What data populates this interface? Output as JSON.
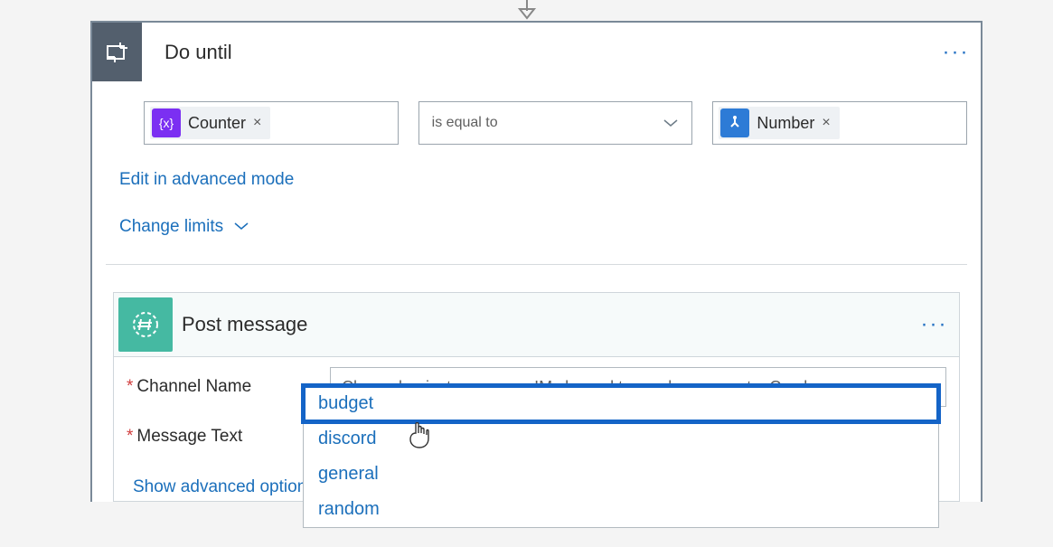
{
  "do_until": {
    "title": "Do until",
    "icon": "loop-icon",
    "menu_label": "···",
    "condition": {
      "left_token": {
        "badge": "{x}",
        "label": "Counter",
        "remove": "×"
      },
      "operator": {
        "label": "is equal to"
      },
      "right_token": {
        "badge": "hand-icon",
        "label": "Number",
        "remove": "×"
      }
    },
    "edit_advanced_link": "Edit in advanced mode",
    "change_limits_link": "Change limits"
  },
  "post_message": {
    "title": "Post message",
    "icon": "hash-icon",
    "menu_label": "···",
    "fields": {
      "channel_name": {
        "label": "Channel Name",
        "required_mark": "*",
        "placeholder": "Channel, private group, or IM channel to send message to. Can be a nam"
      },
      "message_text": {
        "label": "Message Text",
        "required_mark": "*"
      }
    },
    "dropdown_options": [
      "budget",
      "discord",
      "general",
      "random"
    ],
    "selected_option_index": 0,
    "advanced_link": "Show advanced options"
  }
}
